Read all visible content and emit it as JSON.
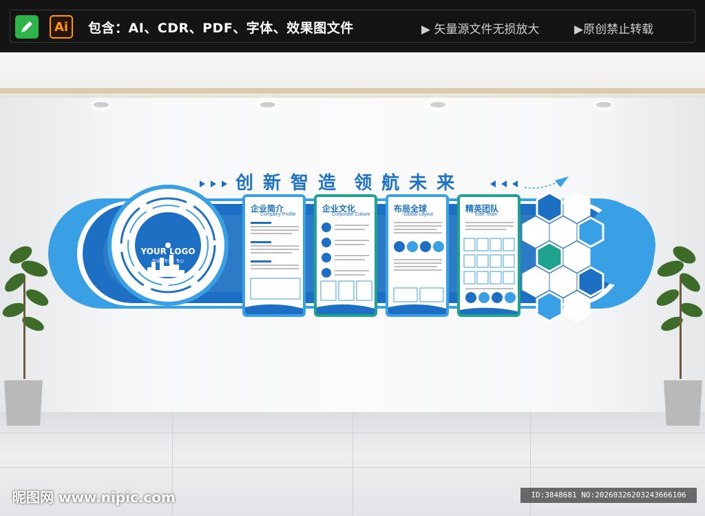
{
  "banner": {
    "includes_text": "包含：AI、CDR、PDF、字体、效果图文件",
    "ai_badge": "Ai",
    "pencil_icon": "pencil-icon",
    "features": [
      "▶ 矢量源文件无损放大",
      "▶原创禁止转载"
    ]
  },
  "wall": {
    "title_chars": [
      "创",
      "新",
      "智",
      "造",
      "领",
      "航",
      "未",
      "来"
    ],
    "logo_text": "YOUR LOGO",
    "logo_tagline": "专业 · 专注 · 专心",
    "panels": [
      {
        "title": "企业简介",
        "subtitle": "Company Profile"
      },
      {
        "title": "企业文化",
        "subtitle": "Corporate Culture"
      },
      {
        "title": "布局全球",
        "subtitle": "Global Layout"
      },
      {
        "title": "精英团队",
        "subtitle": "Elite Team"
      }
    ]
  },
  "footer": {
    "site_watermark": "昵图网 www.nipic.com",
    "image_id": "ID:3848681 NO:20260326203243666106"
  },
  "colors": {
    "brand_blue": "#1c6fc2",
    "light_blue": "#3aa0e6",
    "teal": "#1fa38f",
    "banner_bg": "#141414"
  }
}
